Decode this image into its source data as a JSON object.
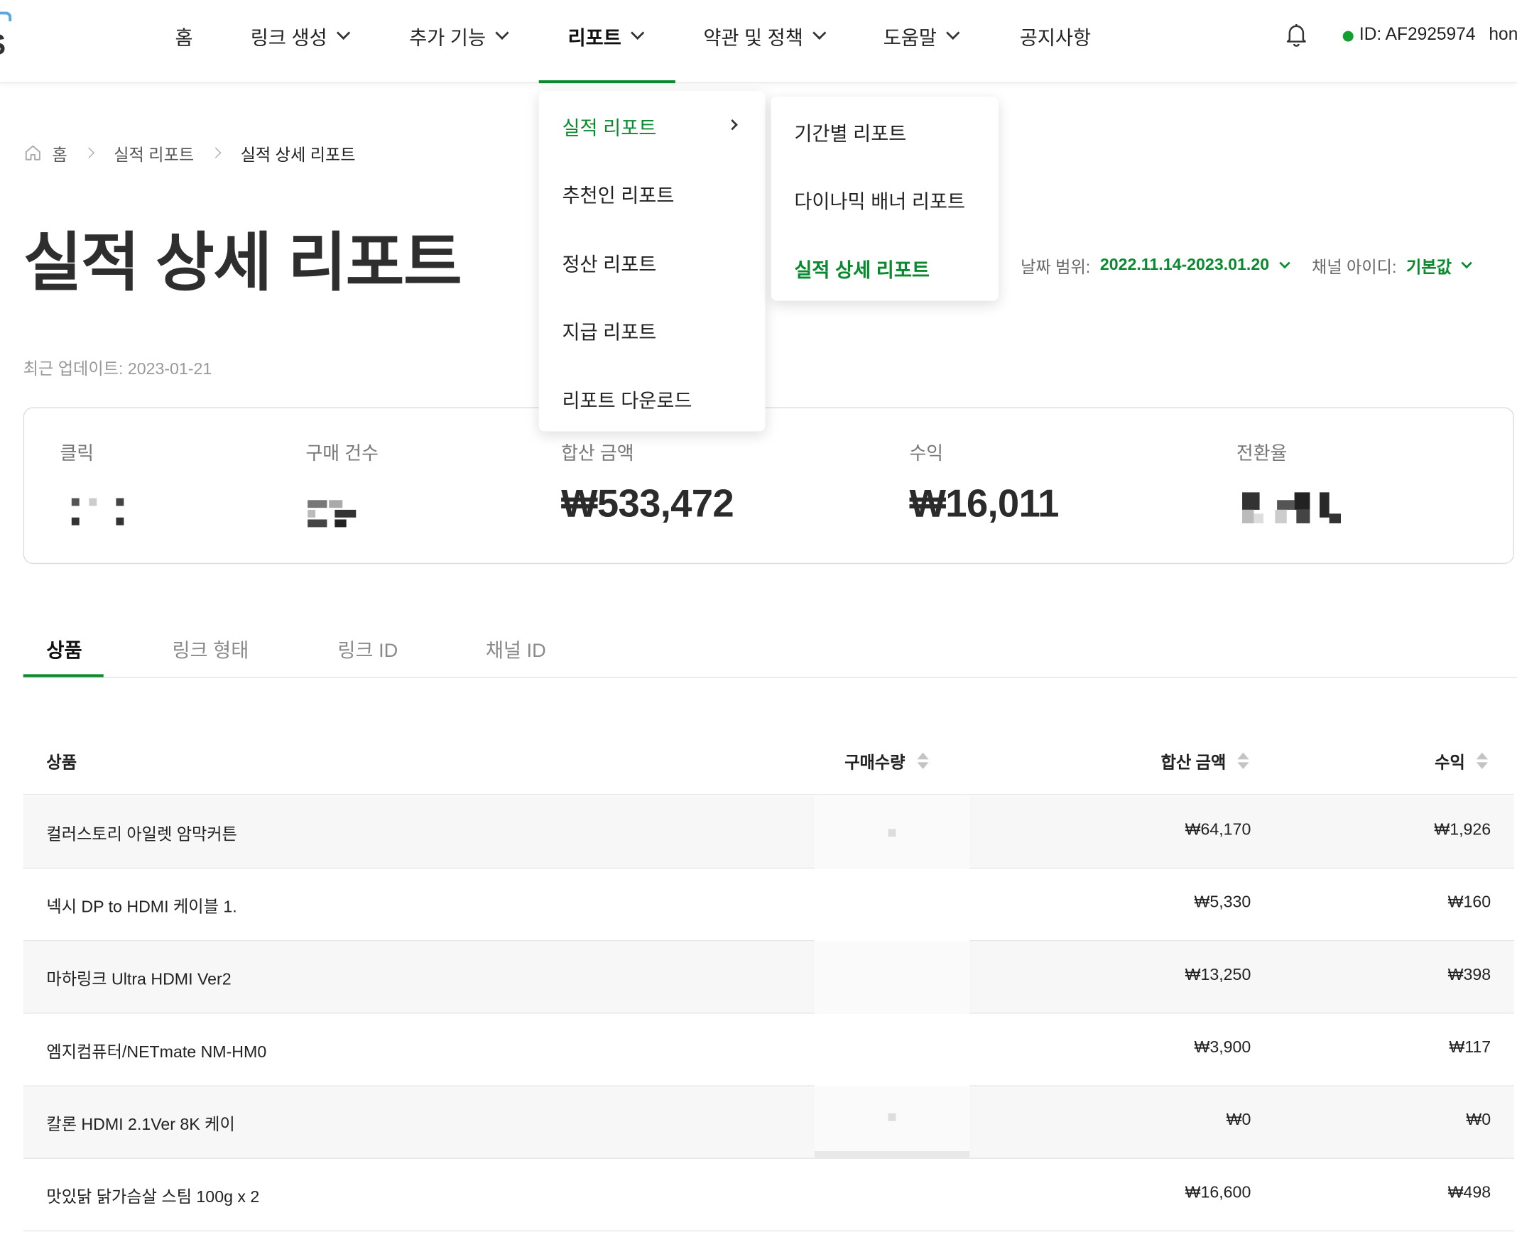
{
  "nav": {
    "items": [
      {
        "label": "홈",
        "has_chevron": false
      },
      {
        "label": "링크 생성",
        "has_chevron": true
      },
      {
        "label": "추가 기능",
        "has_chevron": true
      },
      {
        "label": "리포트",
        "has_chevron": true,
        "active": true
      },
      {
        "label": "약관 및 정책",
        "has_chevron": true
      },
      {
        "label": "도움말",
        "has_chevron": true
      },
      {
        "label": "공지사항",
        "has_chevron": false
      }
    ],
    "user_id": "ID: AF2925974",
    "user_name": "hon",
    "status_color": "#14a02e"
  },
  "report_menu": {
    "items": [
      "실적 리포트",
      "추천인 리포트",
      "정산 리포트",
      "지급 리포트",
      "리포트 다운로드"
    ],
    "active_index": 0
  },
  "performance_submenu": {
    "items": [
      "기간별 리포트",
      "다이나믹 배너 리포트",
      "실적 상세 리포트"
    ],
    "active_index": 2
  },
  "breadcrumb": [
    "홈",
    "실적 리포트",
    "실적 상세 리포트"
  ],
  "page": {
    "title": "실적 상세 리포트",
    "updated": "최근 업데이트: 2023-01-21"
  },
  "filters": {
    "date_label": "날짜 범위:",
    "date_value": "2022.11.14-2023.01.20",
    "channel_label": "채널 아이디:",
    "channel_value": "기본값"
  },
  "summary": {
    "clicks_label": "클릭",
    "purchases_label": "구매 건수",
    "total_label": "합산 금액",
    "total_value": "₩533,472",
    "revenue_label": "수익",
    "revenue_value": "₩16,011",
    "conversion_label": "전환율"
  },
  "tabs": [
    "상품",
    "링크 형태",
    "링크 ID",
    "채널 ID"
  ],
  "table": {
    "headers": {
      "product": "상품",
      "quantity": "구매수량",
      "total": "합산 금액",
      "revenue": "수익"
    },
    "rows": [
      {
        "product": "컬러스토리 아일렛 암막커튼",
        "total": "₩64,170",
        "revenue": "₩1,926"
      },
      {
        "product": "넥시 DP to HDMI 케이블 1.",
        "total": "₩5,330",
        "revenue": "₩160"
      },
      {
        "product": "마하링크 Ultra HDMI Ver2",
        "total": "₩13,250",
        "revenue": "₩398"
      },
      {
        "product": "엠지컴퓨터/NETmate NM-HM0",
        "total": "₩3,900",
        "revenue": "₩117"
      },
      {
        "product": "칼론 HDMI 2.1Ver 8K 케이",
        "total": "₩0",
        "revenue": "₩0"
      },
      {
        "product": "맛있닭 닭가슴살 스팀 100g x 2",
        "total": "₩16,600",
        "revenue": "₩498"
      }
    ]
  },
  "colors": {
    "accent": "#0a8a2e",
    "row_alt": "#f7f7f7"
  }
}
